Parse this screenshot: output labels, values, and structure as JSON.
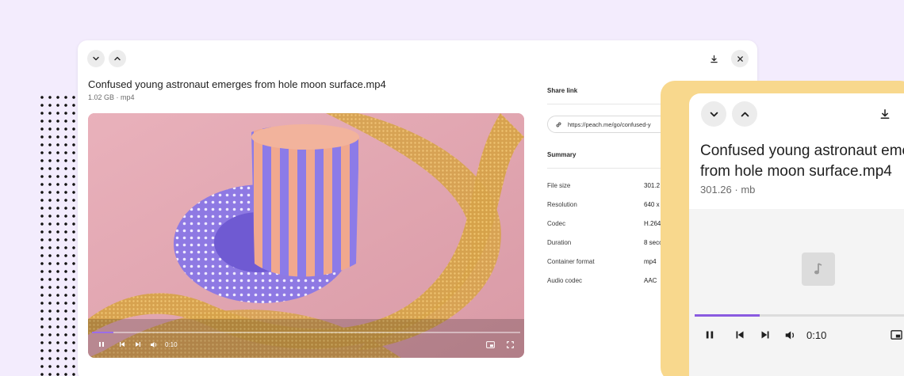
{
  "colors": {
    "background": "#f3ecfd",
    "accent": "#8a5ae0",
    "yellow_card": "#f8d88d"
  },
  "desktop": {
    "nav": {
      "down": "chevron-down-icon",
      "up": "chevron-up-icon",
      "download": "download-icon",
      "close": "close-icon"
    },
    "title": "Confused young astronaut emerges from hole moon surface.mp4",
    "subtitle": "1.02 GB · mp4",
    "player": {
      "time": "0:10",
      "progress": 0.05,
      "controls": [
        "pause-icon",
        "skip-back-icon",
        "skip-forward-icon",
        "volume-icon",
        "picture-in-picture-icon",
        "fullscreen-icon"
      ]
    },
    "share": {
      "label": "Share link",
      "url": "https://peach.me/go/confused-y"
    },
    "summary": {
      "label": "Summary",
      "rows": [
        {
          "label": "File size",
          "value": "301.2"
        },
        {
          "label": "Resolution",
          "value": "640 x"
        },
        {
          "label": "Codec",
          "value": "H.264"
        },
        {
          "label": "Duration",
          "value": "8 seco"
        },
        {
          "label": "Container format",
          "value": "mp4"
        },
        {
          "label": "Audio codec",
          "value": "AAC"
        }
      ]
    }
  },
  "mobile": {
    "title_line1": "Confused young astronaut emer",
    "title_line2": "from hole moon surface.mp4",
    "subtitle": "301.26 · mb",
    "media_icon": "music-note-icon",
    "player": {
      "time": "0:10",
      "progress": 0.29
    }
  }
}
